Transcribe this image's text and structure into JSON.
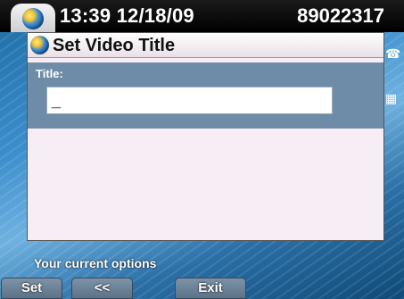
{
  "status_bar": {
    "datetime": "13:39 12/18/09",
    "extension": "89022317",
    "globe_icon": "globe-icon"
  },
  "dialog": {
    "title": "Set Video Title",
    "title_icon": "globe-icon",
    "field_label": "Title:",
    "field_value": "",
    "cursor": "_"
  },
  "options": {
    "label": "Your current options",
    "softkeys": {
      "set": "Set",
      "back": "<<",
      "exit": "Exit"
    }
  },
  "background_icons": [
    "phone-icon",
    "keypad-icon"
  ],
  "colors": {
    "field_panel": "#6e8ca8",
    "dialog_bg": "#f6eef4",
    "softkey": "#6a8095"
  }
}
